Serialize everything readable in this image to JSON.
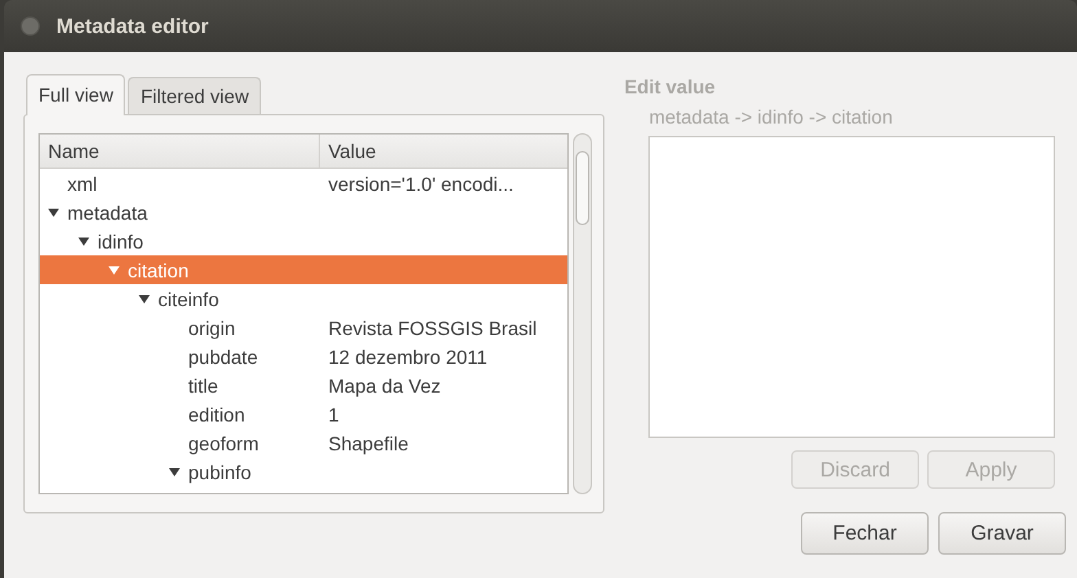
{
  "window": {
    "title": "Metadata editor"
  },
  "tabs": [
    {
      "label": "Full view",
      "selected": true
    },
    {
      "label": "Filtered view",
      "selected": false
    }
  ],
  "tree": {
    "columns": [
      "Name",
      "Value"
    ],
    "rows": [
      {
        "name": "xml",
        "value": "version='1.0' encodi...",
        "selected": false
      },
      {
        "name": "metadata",
        "expanded": true,
        "selected": false,
        "children": [
          {
            "name": "idinfo",
            "expanded": true,
            "selected": false,
            "children": [
              {
                "name": "citation",
                "expanded": true,
                "selected": true,
                "children": [
                  {
                    "name": "citeinfo",
                    "expanded": true,
                    "selected": false,
                    "children": [
                      {
                        "name": "origin",
                        "value": "Revista FOSSGIS Brasil",
                        "selected": false
                      },
                      {
                        "name": "pubdate",
                        "value": "12 dezembro 2011",
                        "selected": false
                      },
                      {
                        "name": "title",
                        "value": "Mapa da Vez",
                        "selected": false
                      },
                      {
                        "name": "edition",
                        "value": "1",
                        "selected": false
                      },
                      {
                        "name": "geoform",
                        "value": "Shapefile",
                        "selected": false
                      },
                      {
                        "name": "pubinfo",
                        "expanded": true,
                        "selected": false
                      }
                    ]
                  }
                ]
              }
            ]
          }
        ]
      }
    ]
  },
  "editor": {
    "title": "Edit value",
    "path": "metadata -> idinfo -> citation",
    "disabled": true
  },
  "edit_buttons": [
    {
      "label": "Discard",
      "disabled": true
    },
    {
      "label": "Apply",
      "disabled": true
    }
  ],
  "dialog_buttons": [
    {
      "label": "Fechar",
      "disabled": false
    },
    {
      "label": "Gravar",
      "disabled": false
    }
  ]
}
